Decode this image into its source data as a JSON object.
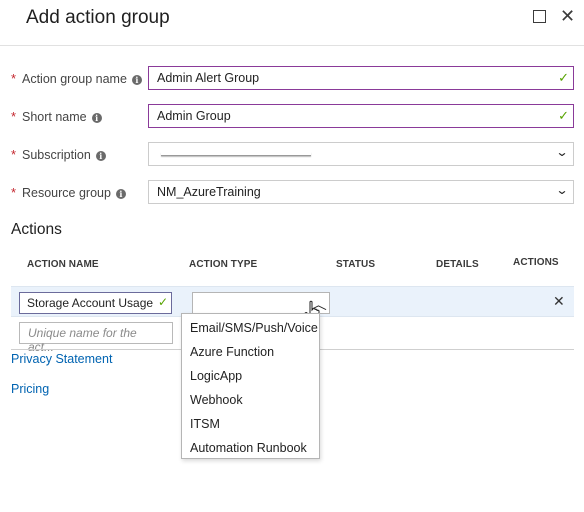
{
  "header": {
    "title": "Add action group",
    "maximize_icon": "maximize-icon",
    "close_icon": "close-icon",
    "close_glyph": "✕"
  },
  "form": {
    "action_group_name": {
      "label": "Action group name",
      "value": "Admin Alert Group",
      "valid": true
    },
    "short_name": {
      "label": "Short name",
      "value": "Admin Group",
      "valid": true
    },
    "subscription": {
      "label": "Subscription",
      "value": ""
    },
    "resource_group": {
      "label": "Resource group",
      "value": "NM_AzureTraining"
    },
    "required_marker": "*",
    "info_glyph": "i",
    "check_glyph": "✓",
    "chevron_glyph": "⌄"
  },
  "actions": {
    "section_title": "Actions",
    "columns": [
      "ACTION NAME",
      "ACTION TYPE",
      "STATUS",
      "DETAILS",
      "ACTIONS"
    ],
    "row": {
      "name": "Storage Account Usage",
      "type": "",
      "delete_glyph": "✕"
    },
    "new_name_placeholder": "Unique name for the act...",
    "type_options": [
      "Email/SMS/Push/Voice",
      "Azure Function",
      "LogicApp",
      "Webhook",
      "ITSM",
      "Automation Runbook"
    ]
  },
  "links": {
    "privacy": "Privacy Statement",
    "pricing": "Pricing"
  },
  "colors": {
    "valid_border": "#8a3a99",
    "check": "#57a300",
    "required": "#c4262e",
    "link": "#0063b1",
    "row_highlight": "#eaf2fb"
  }
}
